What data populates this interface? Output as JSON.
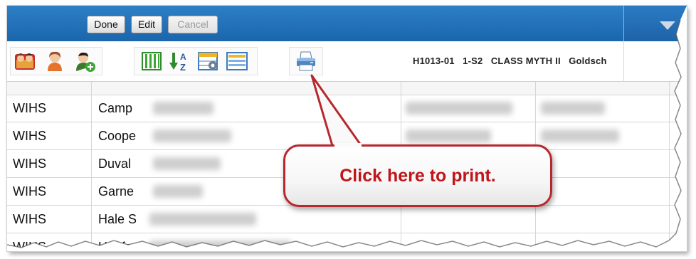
{
  "toolbar": {
    "done_label": "Done",
    "edit_label": "Edit",
    "cancel_label": "Cancel"
  },
  "class_info": {
    "section": "H1013-01",
    "term": "1-S2",
    "course": "CLASS MYTH II",
    "teacher": "Goldsch"
  },
  "icons": {
    "group1": [
      "class-roster-icon",
      "student-icon",
      "add-student-icon"
    ],
    "group2": [
      "columns-icon",
      "sort-az-icon",
      "table-settings-icon",
      "rows-icon"
    ],
    "group3": [
      "printer-icon"
    ]
  },
  "table": {
    "rows": [
      {
        "school": "WIHS",
        "name": "Camp"
      },
      {
        "school": "WIHS",
        "name": "Coope"
      },
      {
        "school": "WIHS",
        "name": "Duval"
      },
      {
        "school": "WIHS",
        "name": "Garne"
      },
      {
        "school": "WIHS",
        "name": "Hale S"
      },
      {
        "school": "WIHS",
        "name": "Hoefg"
      }
    ]
  },
  "callout": {
    "text": "Click here to print."
  },
  "colors": {
    "header_blue": "#1b66ad",
    "callout_border": "#b5282e",
    "callout_text": "#c0151b"
  }
}
